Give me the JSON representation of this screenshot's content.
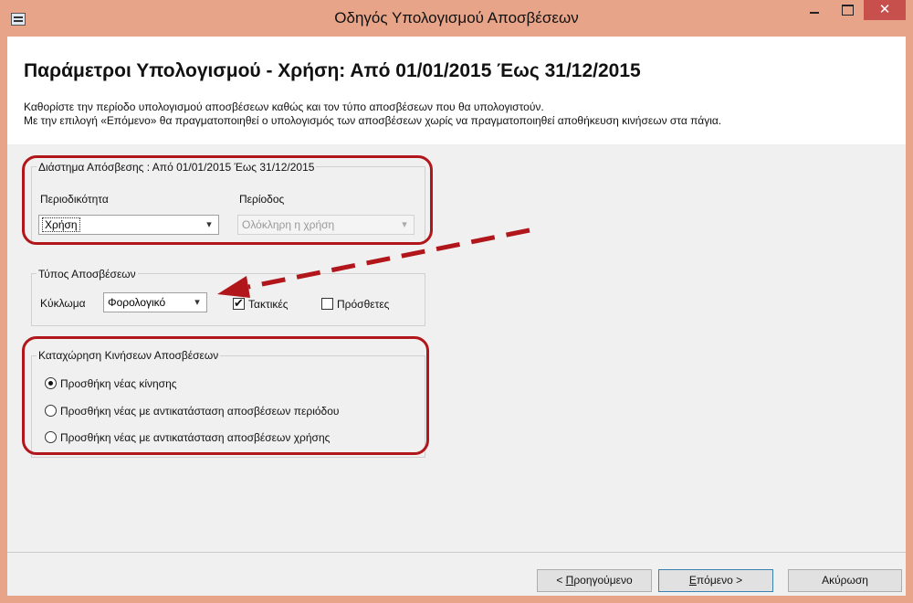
{
  "window": {
    "title": "Οδηγός Υπολογισμού Αποσβέσεων",
    "close_glyph": "✕"
  },
  "header": {
    "title": "Παράμετροι Υπολογισμού - Χρήση: Από 01/01/2015 Έως 31/12/2015",
    "desc_line1": "Καθορίστε την περίοδο υπολογισμού αποσβέσεων καθώς και τον τύπο αποσβέσεων που θα υπολογιστούν.",
    "desc_line2": "Με την επιλογή «Επόμενο» θα πραγματοποιηθεί ο υπολογισμός των αποσβέσεων χωρίς να πραγματοποιηθεί αποθήκευση κινήσεων στα πάγια."
  },
  "period_group": {
    "label": "Διάστημα Απόσβεσης : Από 01/01/2015 Έως 31/12/2015",
    "periodicity_label": "Περιοδικότητα",
    "periodicity_value": "Χρήση",
    "period_label": "Περίοδος",
    "period_value": "Ολόκληρη η χρήση"
  },
  "type_group": {
    "label": "Τύπος Αποσβέσεων",
    "circuit_label": "Κύκλωμα",
    "circuit_value": "Φορολογικό",
    "regular_label": "Τακτικές",
    "regular_checked": true,
    "additional_label": "Πρόσθετες",
    "additional_checked": false
  },
  "entry_group": {
    "label": "Καταχώρηση Κινήσεων Αποσβέσεων",
    "options": [
      {
        "label": "Προσθήκη νέας κίνησης",
        "selected": true
      },
      {
        "label": "Προσθήκη νέας με αντικατάσταση αποσβέσεων περιόδου",
        "selected": false
      },
      {
        "label": "Προσθήκη νέας με αντικατάσταση αποσβέσεων χρήσης",
        "selected": false
      }
    ]
  },
  "footer": {
    "prev_prefix": "< ",
    "prev_accel": "Π",
    "prev_rest": "ροηγούμενο",
    "next_accel": "Ε",
    "next_rest": "πόμενο >",
    "cancel": "Ακύρωση"
  },
  "colors": {
    "titlebar": "#e8a488",
    "close": "#c7504d",
    "highlight": "#b1161b",
    "panel": "#f0f0f0"
  },
  "icons": {
    "dropdown": "▾"
  }
}
